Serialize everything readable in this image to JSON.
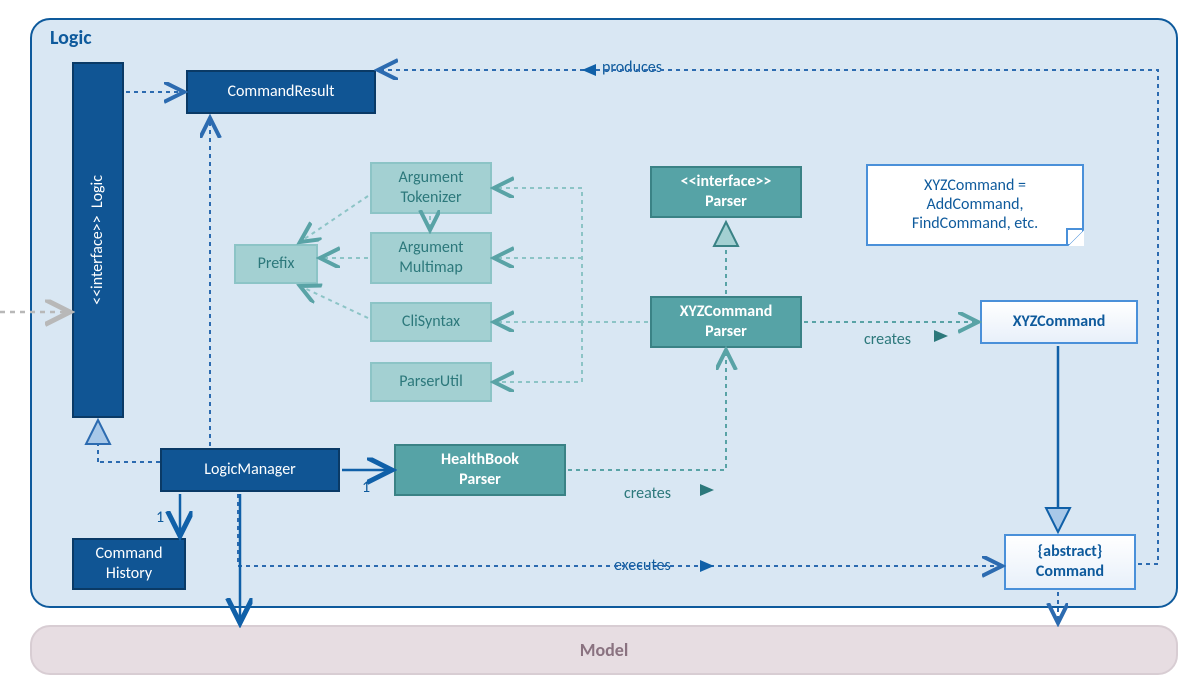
{
  "package": {
    "title": "Logic"
  },
  "nodes": {
    "logic_interface": {
      "stereotype": "<<interface>>",
      "name": "Logic"
    },
    "command_result": "CommandResult",
    "logic_manager": "LogicManager",
    "command_history": "Command\nHistory",
    "argument_tokenizer": "Argument\nTokenizer",
    "prefix": "Prefix",
    "argument_multimap": "Argument\nMultimap",
    "clisyntax": "CliSyntax",
    "parserutil": "ParserUtil",
    "healthbook_parser": "HealthBook\nParser",
    "parser_interface": {
      "stereotype": "<<interface>>",
      "name": "Parser"
    },
    "xyz_command_parser": "XYZCommand\nParser",
    "xyz_command": "XYZCommand",
    "abstract_command": {
      "stereotype": "{abstract}",
      "name": "Command"
    },
    "model": "Model"
  },
  "note": {
    "line1": "XYZCommand =",
    "line2": "AddCommand,",
    "line3": "FindCommand, etc."
  },
  "edges": {
    "produces": "produces",
    "creates1": "creates",
    "creates2": "creates",
    "executes": "executes"
  },
  "multiplicities": {
    "lm_hbp": "1",
    "lm_ch": "1"
  }
}
